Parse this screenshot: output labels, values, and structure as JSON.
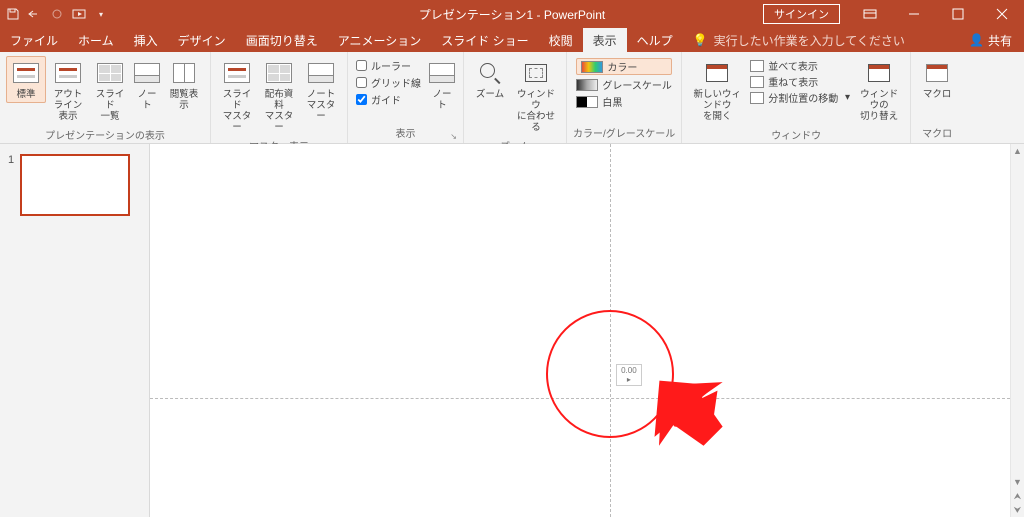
{
  "title": "プレゼンテーション1 - PowerPoint",
  "signin": "サインイン",
  "share": "共有",
  "tellme": "実行したい作業を入力してください",
  "tabs": {
    "file": "ファイル",
    "home": "ホーム",
    "insert": "挿入",
    "design": "デザイン",
    "transitions": "画面切り替え",
    "animations": "アニメーション",
    "slideshow": "スライド ショー",
    "review": "校閲",
    "view": "表示",
    "help": "ヘルプ"
  },
  "ribbon": {
    "presviews": {
      "label": "プレゼンテーションの表示",
      "normal": "標準",
      "outline": "アウトライン\n表示",
      "sorter": "スライド\n一覧",
      "notes": "ノー\nト",
      "reading": "閲覧表示"
    },
    "masters": {
      "label": "マスター表示",
      "slide": "スライド\nマスター",
      "handout": "配布資料\nマスター",
      "notes": "ノート\nマスター"
    },
    "show": {
      "label": "表示",
      "ruler": "ルーラー",
      "grid": "グリッド線",
      "guides": "ガイド",
      "notes": "ノー\nト"
    },
    "zoom": {
      "label": "ズーム",
      "zoom": "ズーム",
      "fit": "ウィンドウ\nに合わせる"
    },
    "color": {
      "label": "カラー/グレースケール",
      "color": "カラー",
      "gray": "グレースケール",
      "bw": "白黒"
    },
    "window": {
      "label": "ウィンドウ",
      "newwin": "新しいウィンドウ\nを開く",
      "arrange": "並べて表示",
      "cascade": "重ねて表示",
      "split": "分割位置の移動",
      "switch": "ウィンドウの\n切り替え"
    },
    "macros": {
      "label": "マクロ",
      "macros": "マクロ"
    }
  },
  "thumb": {
    "n1": "1"
  },
  "measure": "0.00"
}
